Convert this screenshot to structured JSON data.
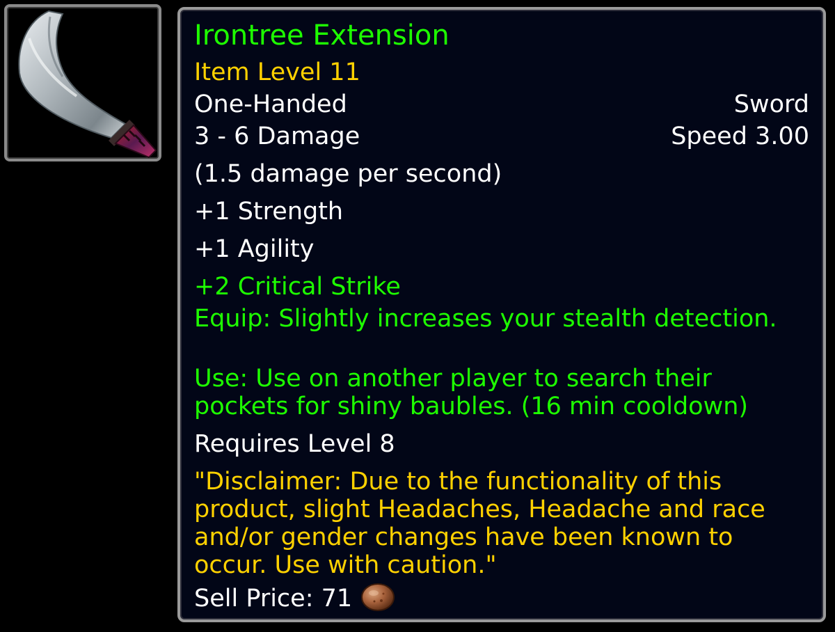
{
  "colors": {
    "name": "#1eff00",
    "item_level": "#ffd100",
    "stats": "#ffffff",
    "bonus": "#1eff00",
    "flavor": "#ffd100",
    "background": "#020617",
    "border": "#9a9a9a"
  },
  "item": {
    "icon": "sword-icon",
    "name": "Irontree Extension",
    "item_level": "Item Level 11",
    "slot": "One-Handed",
    "type": "Sword",
    "damage": "3 - 6 Damage",
    "speed": "Speed 3.00",
    "dps": "(1.5 damage per second)",
    "stats": [
      "+1 Strength",
      "+1 Agility"
    ],
    "bonus_stat": "+2 Critical Strike",
    "equip": "Equip: Slightly increases your stealth detection.",
    "use": "Use: Use on another player to search their pockets for shiny baubles. (16 min cooldown)",
    "requires": "Requires Level 8",
    "flavor": "\"Disclaimer: Due to the functionality of this product, slight Headaches, Headache and race and/or gender changes have been known to occur. Use with caution.\"",
    "sell_price_label": "Sell Price: 71",
    "coin_icon": "copper-coin-icon"
  }
}
